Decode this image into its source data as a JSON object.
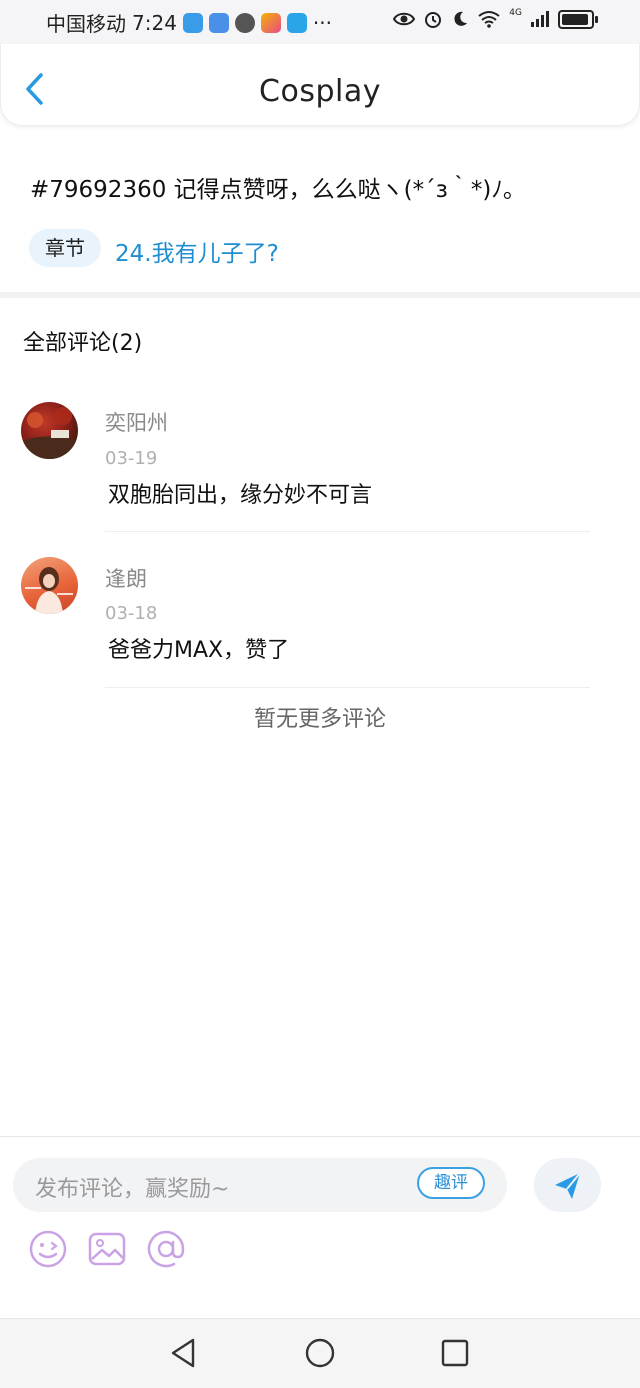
{
  "status_bar": {
    "carrier": "中国移动",
    "time": "7:24",
    "dots": "···",
    "network": "4G"
  },
  "header": {
    "title": "Cosplay"
  },
  "post": {
    "text": "#79692360 记得点赞呀，么么哒ヽ(*´з｀*)ﾉ。",
    "chapter_tag": "章节",
    "chapter_link": "24.我有儿子了?"
  },
  "comments": {
    "title": "全部评论(2)",
    "items": [
      {
        "name": "奕阳州",
        "date": "03-19",
        "text": "双胞胎同出，缘分妙不可言"
      },
      {
        "name": "逢朗",
        "date": "03-18",
        "text": "爸爸力MAX，赞了"
      }
    ],
    "no_more": "暂无更多评论"
  },
  "input_bar": {
    "placeholder": "发布评论，赢奖励~",
    "qp_label": "趣评",
    "accent": "#2b8fd6",
    "tool_color": "#c9a3e6"
  }
}
